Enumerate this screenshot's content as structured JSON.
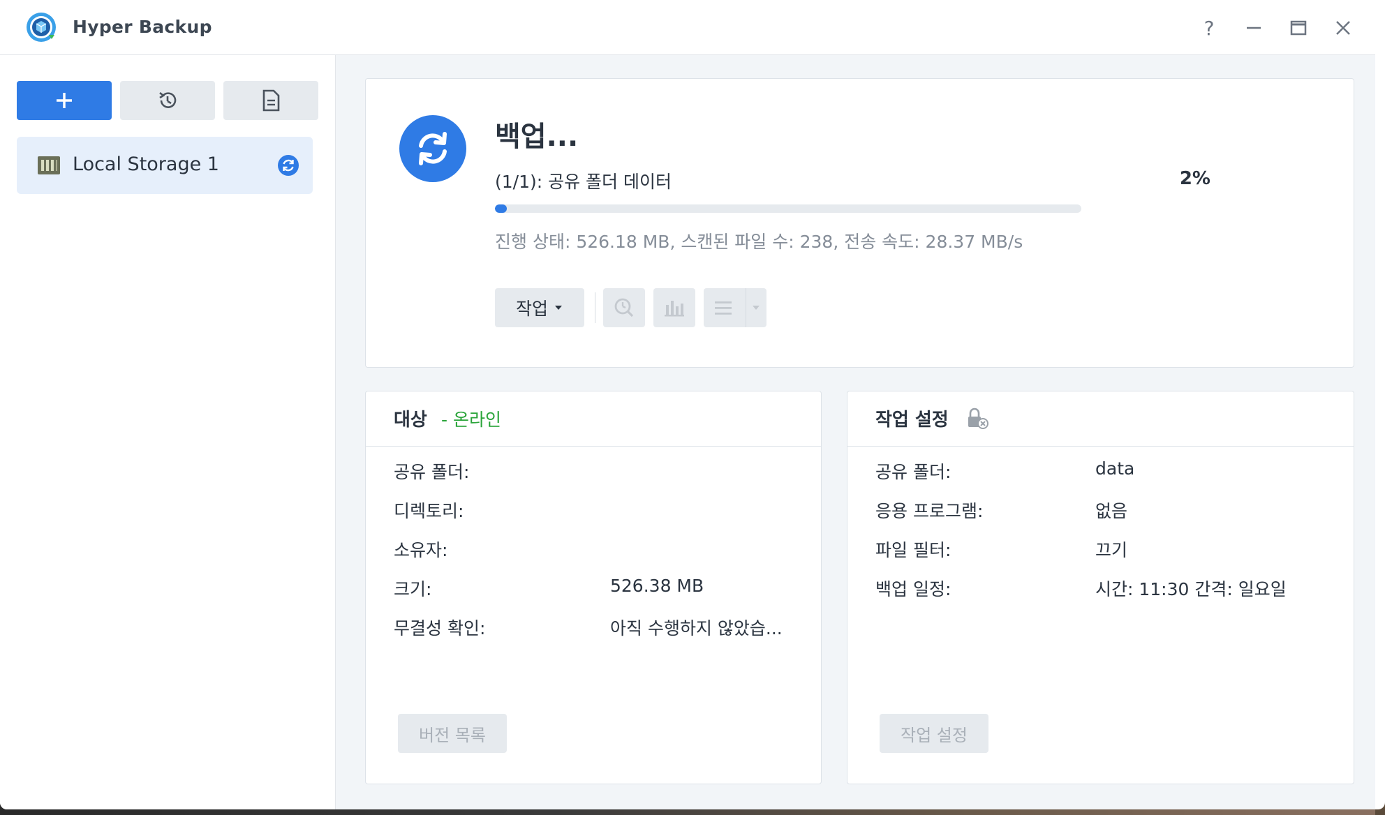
{
  "app": {
    "title": "Hyper Backup"
  },
  "window_controls": {
    "help": "?"
  },
  "toolbar": {
    "add_icon": "plus-icon",
    "restore_icon": "history-icon",
    "log_icon": "document-icon"
  },
  "tasks": [
    {
      "label": "Local Storage 1",
      "icon": "storage-icon",
      "status_icon": "sync-icon"
    }
  ],
  "status": {
    "title": "백업...",
    "progress_label": "(1/1): 공유 폴더 데이터",
    "progress_percent": "2%",
    "progress_value": 2,
    "detail": "진행 상태: 526.18 MB, 스캔된 파일 수: 238, 전송 속도: 28.37 MB/s",
    "action_label": "작업"
  },
  "target": {
    "title": "대상",
    "status": "- 온라인",
    "rows": [
      {
        "label": "공유 폴더:",
        "value": ""
      },
      {
        "label": "디렉토리:",
        "value": ""
      },
      {
        "label": "소유자:",
        "value": ""
      },
      {
        "label": "크기:",
        "value": "526.38 MB"
      },
      {
        "label": "무결성 확인:",
        "value": "아직 수행하지 않았습..."
      }
    ],
    "button": "버전 목록"
  },
  "settings": {
    "title": "작업 설정",
    "rows": [
      {
        "label": "공유 폴더:",
        "value": "data"
      },
      {
        "label": "응용 프로그램:",
        "value": "없음"
      },
      {
        "label": "파일 필터:",
        "value": "끄기"
      },
      {
        "label": "백업 일정:",
        "value": "시간: 11:30 간격: 일요일"
      }
    ],
    "button": "작업 설정"
  },
  "colors": {
    "accent": "#2f7be5",
    "online": "#2aa43a",
    "text": "#2b3440",
    "muted": "#858d98"
  }
}
